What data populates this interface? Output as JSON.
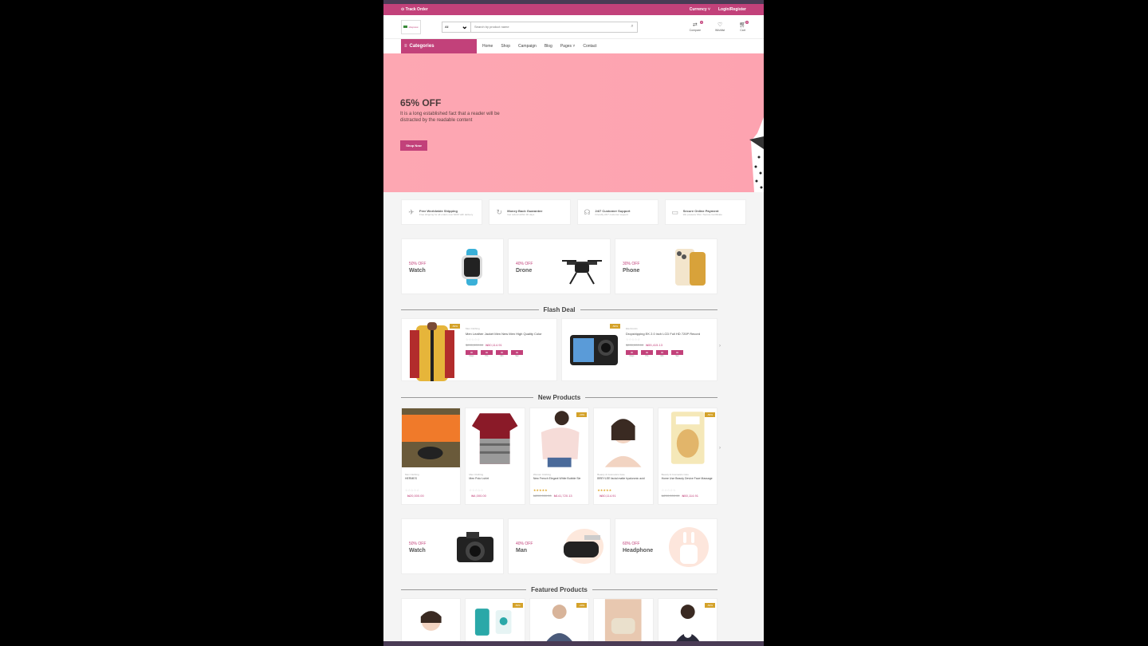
{
  "topbar": {
    "track_order": "Track Order",
    "currency": "Currency",
    "login": "Login/Register"
  },
  "header": {
    "search_category": "All",
    "search_placeholder": "Search by product name",
    "compare": "Compare",
    "compare_count": "0",
    "wishlist": "Wishlist",
    "cart": "Cart",
    "cart_count": "0"
  },
  "nav": {
    "categories": "Categories",
    "items": [
      "Home",
      "Shop",
      "Campaign",
      "Blog",
      "Pages",
      "Contact"
    ]
  },
  "hero": {
    "title": "65% OFF",
    "text": "It is a long established fact that a reader will be distracted by the readable content",
    "button": "Shop Now"
  },
  "features": [
    {
      "icon": "plane-icon",
      "title": "Free Worldwide Shipping",
      "desc": "Free shipping for all orders over $100 with delivery"
    },
    {
      "icon": "refresh-icon",
      "title": "Money Back Guarantee",
      "desc": "Get refund within 30 days"
    },
    {
      "icon": "headset-icon",
      "title": "24/7 Customer Support",
      "desc": "Friendly 24/7 customer support"
    },
    {
      "icon": "card-icon",
      "title": "Secure Online Payment",
      "desc": "We possess SSL / Secure Certificate"
    }
  ],
  "promos1": [
    {
      "off": "50% OFF",
      "name": "Watch"
    },
    {
      "off": "40% OFF",
      "name": "Drone"
    },
    {
      "off": "30% OFF",
      "name": "Phone"
    }
  ],
  "flash": {
    "title": "Flash Deal",
    "items": [
      {
        "tag": "-50%",
        "cat": "Men Clothing",
        "title": "Men Leather Jacket Men New Men High Quality Color",
        "old": "$200,000.00",
        "price": "₦50,114.91",
        "t": [
          "00",
          "00",
          "00",
          "00"
        ]
      },
      {
        "tag": "-50%",
        "cat": "Electronics",
        "title": "Dropshipping EK 2.0 inch LCD Full HD 720P Record",
        "old": "$200,000.00",
        "price": "₦55,415.13",
        "t": [
          "00",
          "00",
          "00",
          "00"
        ]
      }
    ],
    "labels": [
      "Days",
      "Hrs",
      "Min",
      "Sec"
    ]
  },
  "new_products": {
    "title": "New Products",
    "items": [
      {
        "cat": "Men Clothing",
        "title": "HERMES",
        "old": "",
        "price": "₦20,000.00",
        "tag": ""
      },
      {
        "cat": "Men Clothing",
        "title": "Men Polo t-shirt",
        "old": "",
        "price": "₦4,000.00",
        "tag": ""
      },
      {
        "cat": "Women Clothing",
        "title": "New French Elegant White Bubble Sle",
        "old": "₦200,000.00",
        "price": "₦141,720.13",
        "tag": "-20%"
      },
      {
        "cat": "Beauty & Cosmetics Care",
        "title": "BREYLEE facial matte hyaluronic acid",
        "old": "",
        "price": "₦50,114.91",
        "tag": ""
      },
      {
        "cat": "Beauty & Cosmetics Care",
        "title": "Home Use Beauty Device Face Massage",
        "old": "₦200,000.00",
        "price": "₦50,114.91",
        "tag": "-50%"
      }
    ]
  },
  "promos2": [
    {
      "off": "50% OFF",
      "name": "Watch"
    },
    {
      "off": "40% OFF",
      "name": "Man"
    },
    {
      "off": "60% OFF",
      "name": "Headphone"
    }
  ],
  "featured": {
    "title": "Featured Products",
    "tags": [
      "",
      "-50%",
      "-20%",
      "",
      "-50%"
    ]
  },
  "colors": {
    "accent": "#c2417a",
    "hero": "#fda7b2",
    "badge": "#d4a22a"
  }
}
